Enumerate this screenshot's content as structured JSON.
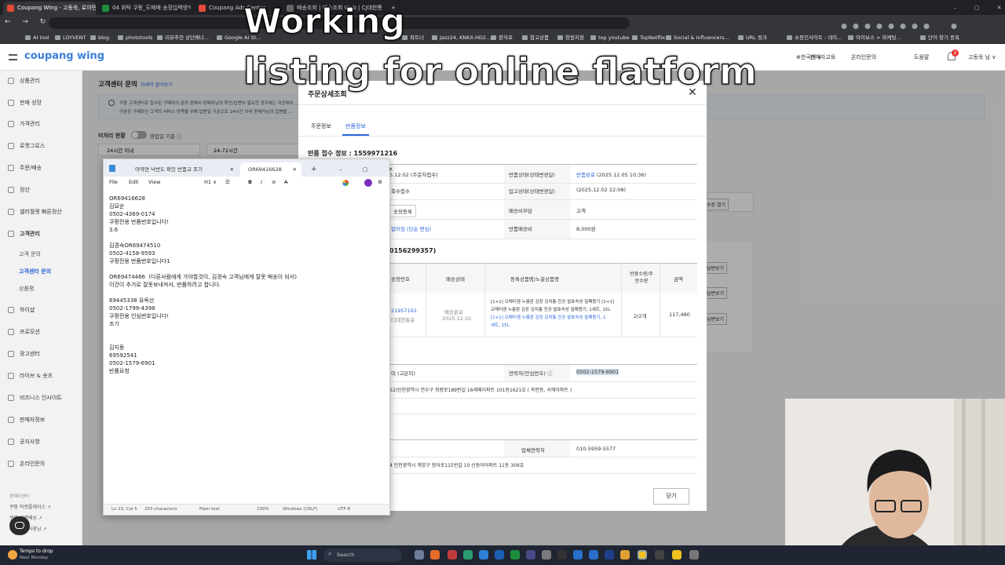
{
  "browser": {
    "tabs": [
      {
        "label": "Coupang Wing - 고동욱, 로이민",
        "color": "#e54a3a"
      },
      {
        "label": "04 위탁 쿠팡_도매매 송장입력양식",
        "color": "#1e8e3e"
      },
      {
        "label": "Coupang Ads Center",
        "color": "#e54a3a"
      },
      {
        "label": "배송조회 | 배송조회 Web | CJ대한통",
        "color": "#555"
      }
    ],
    "bookmarks": [
      "AI tool",
      "LOYVENT",
      "blog",
      "phototools",
      "리뷰추천 상단배너...",
      "Google AI St...",
      "파트너",
      "Jazz24, KNKX-HD2...",
      "판자포",
      "참고상품",
      "창원지원",
      "top youtube",
      "TopNetflix",
      "Social & Influencers...",
      "URL 링크",
      "쇼핑인사이트 : 네이...",
      "아이보스 > 마케팅...",
      "단어 찾기 종목"
    ]
  },
  "header": {
    "logo": "coupang wing",
    "nav": [
      "⊕한국어 ∨",
      "판매자교육",
      "온라인문의",
      "도움말",
      "고동욱 님 ∨"
    ],
    "notif_count": "2"
  },
  "sidebar": {
    "items": [
      "상품관리",
      "판매 성장",
      "가격관리",
      "로켓그로스",
      "주문/배송",
      "정산",
      "셀러월렛 빠른정산",
      "고객관리",
      "하이샵",
      "프로모션",
      "광고센터",
      "라이브 & 숏츠",
      "비즈니스 인사이트",
      "판매자정보",
      "공지사항",
      "온라인문의"
    ],
    "subitems": [
      "고객 문의",
      "고객센터 문의",
      "상품평"
    ],
    "footer": [
      "판매자센터",
      "쿠팡 마켓플레이스 ↗",
      "쿠팡 로켓배송 ↗",
      "쿠팡이츠 사장님 ↗"
    ]
  },
  "page": {
    "title": "고객센터 문의",
    "title_link": "자세히 알아보기",
    "notice": "쿠팡 고객센터로 접수된 구매자의 문의 중에서 판매자님의 확인/답변이 필요한 경우에는 이곳에서 ...",
    "notice2": "구분은 구매하신 고객의 서비스 만족을 위해 답변일 기준으로 24시간 이내 판매자님의 답변을 ...",
    "filter_label": "미처리 현황",
    "toggle_label": "영업일 기준 ⓘ",
    "col1": "24시간 이내",
    "col2": "24-72시간",
    "side_buttons": [
      "송장 열기",
      "답변보기",
      "답변보기",
      "답변보기"
    ]
  },
  "modal": {
    "title": "주문상세조회",
    "tabs": [
      "주문정보",
      "반품정보"
    ],
    "receipt": "반품 접수 정보 : 1559971216",
    "rows": [
      {
        "l_val": "5.12.02 (주문자접수)",
        "label": "반품상태(상태변경일)",
        "val_link": "반품완료",
        "val": " (2025.12.05 10:36)"
      },
      {
        "l_val": "회수접수",
        "label": "입고상태(상태변경일)",
        "val": "(2025.12.02 22:08)"
      },
      {
        "l_val": "송장등록",
        "label": "배송비부담",
        "val": "고객"
      },
      {
        "l_val": "없어짐 (단순 변심)",
        "label": "반품배송비",
        "val": "8,000원"
      }
    ],
    "section2": "0156299357)",
    "table_headers": [
      "송장번호",
      "배송상태",
      "등록상품명/노출상품명",
      "반품수량/주문수량",
      "금액"
    ],
    "table_row": {
      "invoice": "21957161",
      "carrier": "CJ대한통운",
      "status": "배송완료",
      "status_date": "2025.12.02",
      "product1": "[1+1] 오메티엠 누름판 김장 김치통 진공 발효숙성 밀폐용기 [1+1]",
      "product2": "오메티엠 누름판 김장 김치통 진공 발효숙성 밀폐용기, 1세트, 15L",
      "product3": "[1+1] 오메티엠 누름판 김장 김치통 진공 발효숙성 밀폐용기, 1",
      "product4": "세트, 15L",
      "qty": "2/2개",
      "amount": "117,480"
    },
    "contact_l": "미 (고은미)",
    "contact_label": "연락처(안심번호) ⓘ",
    "contact_val": "0502-1579-6901",
    "address1": "52)인천광역시 연수구 청량로189번길 16세메이파트 101동1621호 ( 옥련동, 서해아파트 )",
    "biz_label": "업체연락처",
    "biz_val": "010-5959-5577",
    "address2": "4 인천광역시 계양구 향어로115번길 10 신동아아파트 11동 309호",
    "close": "닫기"
  },
  "notepad": {
    "tabs": [
      "아약연 낙번도 확인 반품교  조기",
      "OR69416628"
    ],
    "menu": [
      "File",
      "Edit",
      "View"
    ],
    "heading": "H1 ∨",
    "text": "OR69416628\n김묘순\n0502-4369-0174\n쿠팡전용 반품번호입니다!\n3.6\n\n김경숙OR69474510\n0502-4158-9593\n쿠팡전용 반품번호입니다1\n\nOR69474466  (다른사람에게 가야할것이, 김경숙 고객님에게 잘못 배송이 되서)\n이건이 추가로 잘못보내져서, 반품하려고 합니다.\n\n69445338 유옥선\n0502-1799-4398\n쿠팡전용 인심번호입니다!\n조기\n\n\n김지동\n69592541\n0502-1579-6901\n반품요청",
    "status": [
      "Ln 23, Col 5",
      "253 characters",
      "Plain text",
      "100%",
      "Windows (CRLF)",
      "UTF-8"
    ]
  },
  "caption": {
    "line1": "Working",
    "line2": "listing for online flatform"
  },
  "taskbar": {
    "weather": "Temps to drop",
    "weather_sub": "Next Monday",
    "search": "Search"
  }
}
